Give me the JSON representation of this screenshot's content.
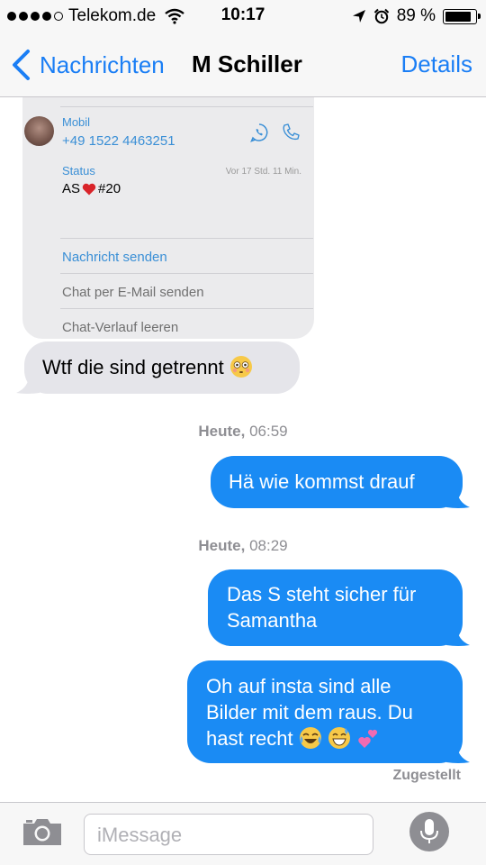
{
  "status_bar": {
    "carrier": "Telekom.de",
    "time": "10:17",
    "battery_percent": "89 %",
    "battery_level": 0.89,
    "signal_bars_filled": 4,
    "signal_bars_total": 5,
    "icons": [
      "wifi-icon",
      "location-arrow-icon",
      "alarm-icon",
      "battery-icon"
    ]
  },
  "nav": {
    "back_label": "Nachrichten",
    "title": "M Schiller",
    "details_label": "Details"
  },
  "contact_card": {
    "phone_label": "Mobil",
    "phone_number": "+49 1522 4463251",
    "status_label": "Status",
    "status_time": "Vor 17 Std. 11 Min.",
    "status_text_prefix": "AS",
    "status_text_suffix": " #20",
    "actions": {
      "send_message": "Nachricht senden",
      "email_chat": "Chat per E-Mail senden",
      "clear_chat": "Chat-Verlauf leeren"
    }
  },
  "messages": {
    "incoming_1": "Wtf die sind getrennt",
    "stamp_1_day": "Heute,",
    "stamp_1_time": " 06:59",
    "outgoing_1": "Hä wie kommst drauf",
    "stamp_2_day": "Heute,",
    "stamp_2_time": " 08:29",
    "outgoing_2_line1": "Das S steht sicher für",
    "outgoing_2_line2": "Samantha",
    "outgoing_3_line1": "Oh auf insta sind alle",
    "outgoing_3_line2": "Bilder mit dem raus. Du",
    "outgoing_3_line3": "hast recht",
    "delivered": "Zugestellt"
  },
  "input": {
    "placeholder": "iMessage"
  },
  "colors": {
    "accent": "#1a7ef5",
    "outgoing_bubble": "#1a8bf4",
    "incoming_bubble": "#e5e5ea",
    "card_background": "#ebebed"
  }
}
